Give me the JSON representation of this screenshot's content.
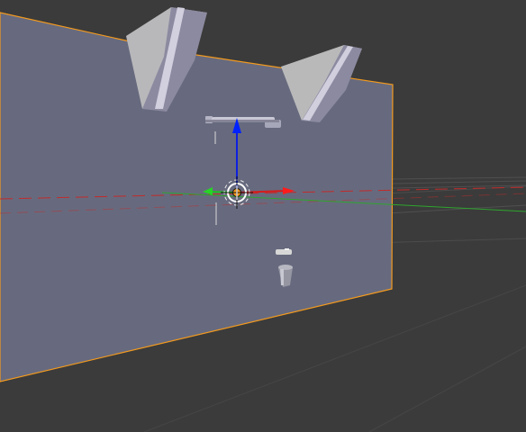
{
  "viewport": {
    "background_color": "#3b3b3b",
    "selection_outline_color": "#f39a1e",
    "axis_x_color": "#c12b2b",
    "axis_y_color": "#2da52d",
    "gizmo_z_color": "#1f3cff",
    "gizmo_x_color": "#d51c1c",
    "gizmo_y_color": "#20c020",
    "mesh_face_color": "#676a7e",
    "grid_line_color": "#4d4d4d"
  },
  "objects": {
    "selected_panel": {
      "icon": "plane-mesh",
      "selected": true
    },
    "bracket_left": {
      "icon": "bracket-mesh"
    },
    "bracket_right": {
      "icon": "bracket-mesh"
    },
    "wrench": {
      "icon": "wrench-mesh"
    },
    "cup": {
      "icon": "cup-mesh"
    },
    "small_part": {
      "icon": "part-mesh"
    }
  },
  "gizmo": {
    "cursor_icon": "3d-cursor-icon",
    "translate_icon": "translate-gizmo-icon"
  }
}
